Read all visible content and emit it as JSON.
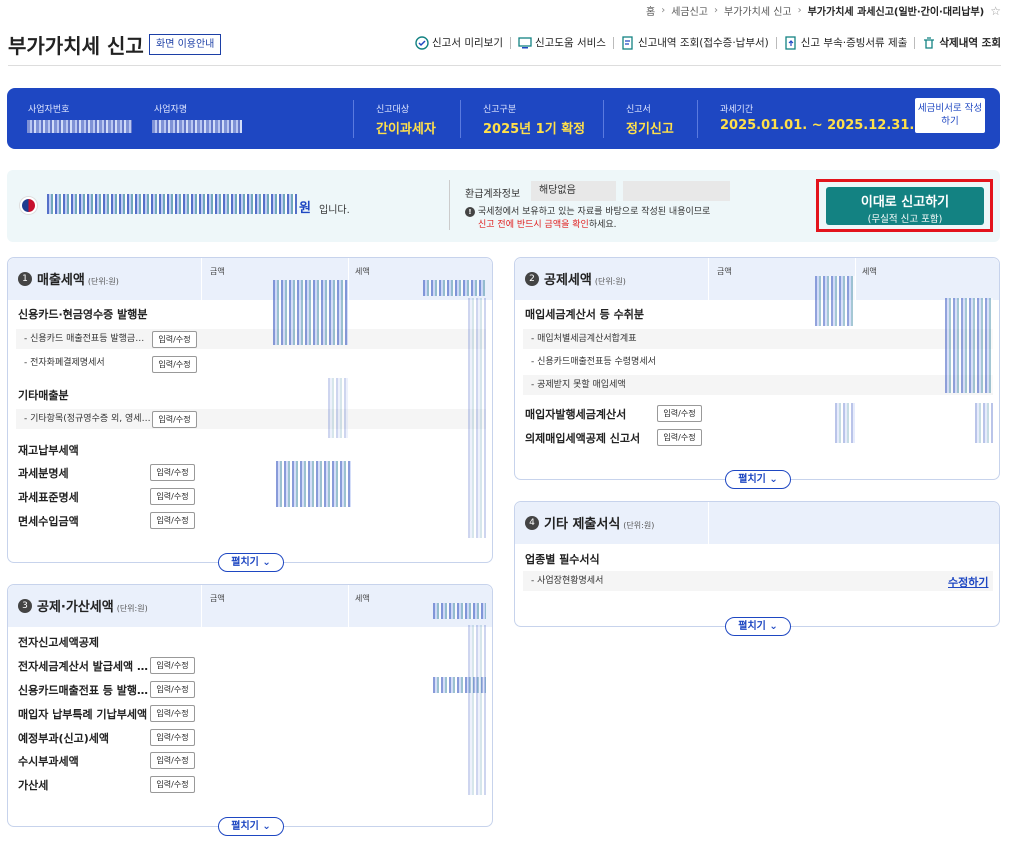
{
  "breadcrumb": [
    "홈",
    "세금신고",
    "부가가치세 신고",
    "부가가치세 과세신고(일반·간이·대리납부)"
  ],
  "page_title": "부가가치세 신고",
  "guide_button": "화면 이용안내",
  "toolbar": [
    {
      "label": "신고서 미리보기",
      "icon": "document-check-icon"
    },
    {
      "label": "신고도움 서비스",
      "icon": "help-screen-icon"
    },
    {
      "label": "신고내역 조회(접수증·납부서)",
      "icon": "list-search-icon"
    },
    {
      "label": "신고 부속·증빙서류 제출",
      "icon": "upload-document-icon"
    },
    {
      "label": "삭제내역 조회",
      "icon": "trash-icon"
    }
  ],
  "info": {
    "biz_no_label": "사업자번호",
    "biz_name_label": "사업자명",
    "target_label": "신고대상",
    "target_value": "간이과세자",
    "type_label": "신고구분",
    "type_value": "2025년 1기 확정",
    "form_label": "신고서",
    "form_value": "정기신고",
    "period_label": "과세기간",
    "period_value": "2025.01.01. ~ 2025.12.31.",
    "write_button": "세금비서로 작성하기"
  },
  "notice": {
    "won": "원",
    "suffix": "입니다.",
    "refund_label": "환급계좌정보",
    "refund_value": "해당없음",
    "note_line1": "국세청에서 보유하고 있는 자료를 바탕으로 작성된 내용이므로",
    "note_red": "신고 전에 반드시 금액을 확인",
    "note_end": "하세요.",
    "submit_l1": "이대로 신고하기",
    "submit_l2": "(무실적 신고 포함)"
  },
  "common": {
    "amount": "금액",
    "tax": "세액",
    "unit": "(단위:원)",
    "edit": "입력/수정",
    "expand": "펼치기 ⌄"
  },
  "p1": {
    "num": "1",
    "title": "매출세액",
    "h1": "신용카드·현금영수증 발행분",
    "s1": "- 신용카드 매출전표등 발행금…",
    "s2": "- 전자화폐결제명세서",
    "h2": "기타매출분",
    "s3": "- 기타항목(정규영수증 외, 영세…",
    "h3": "재고납부세액",
    "h4": "과세분명세",
    "h5": "과세표준명세",
    "h6": "면세수입금액"
  },
  "p2": {
    "num": "2",
    "title": "공제세액",
    "h1": "매입세금계산서 등 수취분",
    "s1": "- 매입처별세금계산서합계표",
    "s2": "- 신용카드매출전표등 수령명세서",
    "s3": "- 공제받지 못할 매입세액",
    "h2": "매입자발행세금계산서",
    "h3": "의제매입세액공제 신고서"
  },
  "p3": {
    "num": "3",
    "title": "공제·가산세액",
    "h1": "전자신고세액공제",
    "h2": "전자세금계산서 발급세액 …",
    "h3": "신용카드매출전표 등 발행…",
    "h4": "매입자 납부특례 기납부세액",
    "h5": "예정부과(신고)세액",
    "h6": "수시부과세액",
    "h7": "가산세"
  },
  "p4": {
    "num": "4",
    "title": "기타 제출서식",
    "h1": "업종별 필수서식",
    "s1": "- 사업장현황명세서",
    "edit_link": "수정하기"
  }
}
